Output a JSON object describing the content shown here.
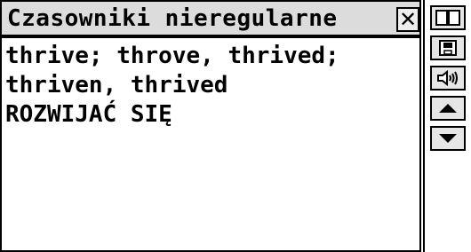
{
  "window": {
    "title": "Czasowniki nieregularne"
  },
  "content": {
    "lines": [
      "thrive; throve, thrived;",
      "thriven, thrived",
      "ROZWIJAĆ SIĘ"
    ]
  },
  "icons": [
    "book-icon",
    "save-icon",
    "speaker-icon",
    "arrow-up-icon",
    "arrow-down-icon",
    "close-icon"
  ]
}
